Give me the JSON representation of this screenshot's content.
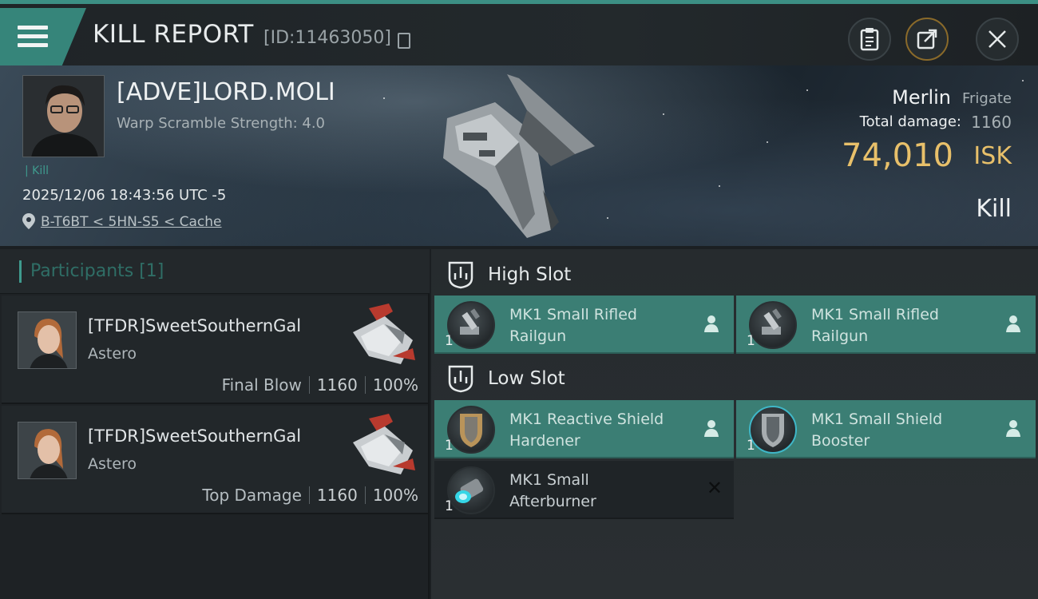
{
  "header": {
    "title": "KILL REPORT",
    "report_id": "[ID:11463050]",
    "buttons": [
      "clipboard-icon",
      "share-icon",
      "close-icon"
    ]
  },
  "victim": {
    "name": "[ADVE]LORD.MOLI",
    "subtitle": "Warp Scramble Strength: 4.0",
    "tag": "Kill",
    "datetime": "2025/12/06 18:43:56 UTC -5",
    "location": "B-T6BT < 5HN-S5 < Cache"
  },
  "ship": {
    "name": "Merlin",
    "class": "Frigate",
    "damage_label": "Total damage:",
    "damage_value": "1160",
    "isk_value": "74,010",
    "isk_unit": "ISK",
    "result": "Kill"
  },
  "participants": {
    "title": "Participants [1]",
    "items": [
      {
        "name": "[TFDR]SweetSouthernGal",
        "ship": "Astero",
        "role": "Final Blow",
        "damage": "1160",
        "percent": "100%"
      },
      {
        "name": "[TFDR]SweetSouthernGal",
        "ship": "Astero",
        "role": "Top Damage",
        "damage": "1160",
        "percent": "100%"
      }
    ]
  },
  "fitting": {
    "high_slot": {
      "title": "High Slot",
      "modules": [
        {
          "name_line1": "MK1 Small Rifled",
          "name_line2": "Railgun",
          "qty": "1",
          "status": "dropped"
        },
        {
          "name_line1": "MK1 Small Rifled",
          "name_line2": "Railgun",
          "qty": "1",
          "status": "dropped"
        }
      ]
    },
    "low_slot": {
      "title": "Low Slot",
      "modules": [
        {
          "name_line1": "MK1 Reactive Shield",
          "name_line2": "Hardener",
          "qty": "1",
          "status": "dropped"
        },
        {
          "name_line1": "MK1 Small Shield",
          "name_line2": "Booster",
          "qty": "1",
          "status": "dropped"
        },
        {
          "name_line1": "MK1 Small",
          "name_line2": "Afterburner",
          "qty": "1",
          "status": "destroyed"
        }
      ]
    }
  },
  "colors": {
    "accent": "#3c8f84",
    "isk": "#e8c06a",
    "module_dropped": "#3b7e74",
    "module_destroyed": "#1f2427"
  }
}
